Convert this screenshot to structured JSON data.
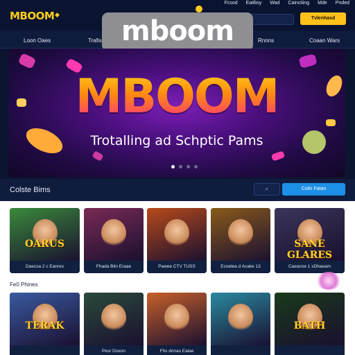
{
  "header": {
    "logo": "MBOOM",
    "top_links": [
      "Fcsod",
      "Eaitlioy",
      "Wad",
      "Cainctiing",
      "Mde",
      "Pnded"
    ],
    "search_placeholder": "",
    "cta_label": "Tvlenhasd"
  },
  "overlay": {
    "brand": "mboom"
  },
  "nav": {
    "items": [
      "Loon Oaes",
      "Trafis",
      "Rnnns",
      "Coaan Wars"
    ]
  },
  "hero": {
    "title": "MBOOM",
    "subtitle": "Trotalling ad Schptic Pams",
    "slides": 4,
    "active_slide": 0
  },
  "section": {
    "title": "Colste Bims",
    "search_icon": "search-icon",
    "cta_label": "Coiln Fatan",
    "second_row_label": "Fe0 Phines"
  },
  "games": {
    "row1": [
      {
        "name": "OARUS",
        "caption": "Daecsa 2 c Eanres",
        "color": "#3a8a3a"
      },
      {
        "name": "",
        "caption": "Fhada Blin Eraae",
        "color": "#7a2a55"
      },
      {
        "name": "",
        "caption": "Pawee CTV TUSS",
        "color": "#b84a1a"
      },
      {
        "name": "",
        "caption": "Ecoelea d Acake 13",
        "color": "#8a5a1a"
      },
      {
        "name": "SANE GLARES",
        "caption": "Caeacoe 1 sDhaeam",
        "color": "#3a3558"
      }
    ],
    "row2": [
      {
        "name": "TERAK",
        "caption": "",
        "color": "#3a5aa0"
      },
      {
        "name": "",
        "caption": "Pesr Dceon",
        "color": "#2a4a3a"
      },
      {
        "name": "",
        "caption": "Fhs dnnas Ealae",
        "color": "#c8602a"
      },
      {
        "name": "",
        "caption": "",
        "color": "#2a8aa0"
      },
      {
        "name": "BATH",
        "caption": "",
        "color": "#1a3a1a"
      }
    ]
  },
  "colors": {
    "brand_yellow": "#ffcc1a",
    "cta_blue": "#1e8fe6",
    "background": "#0b1530"
  }
}
